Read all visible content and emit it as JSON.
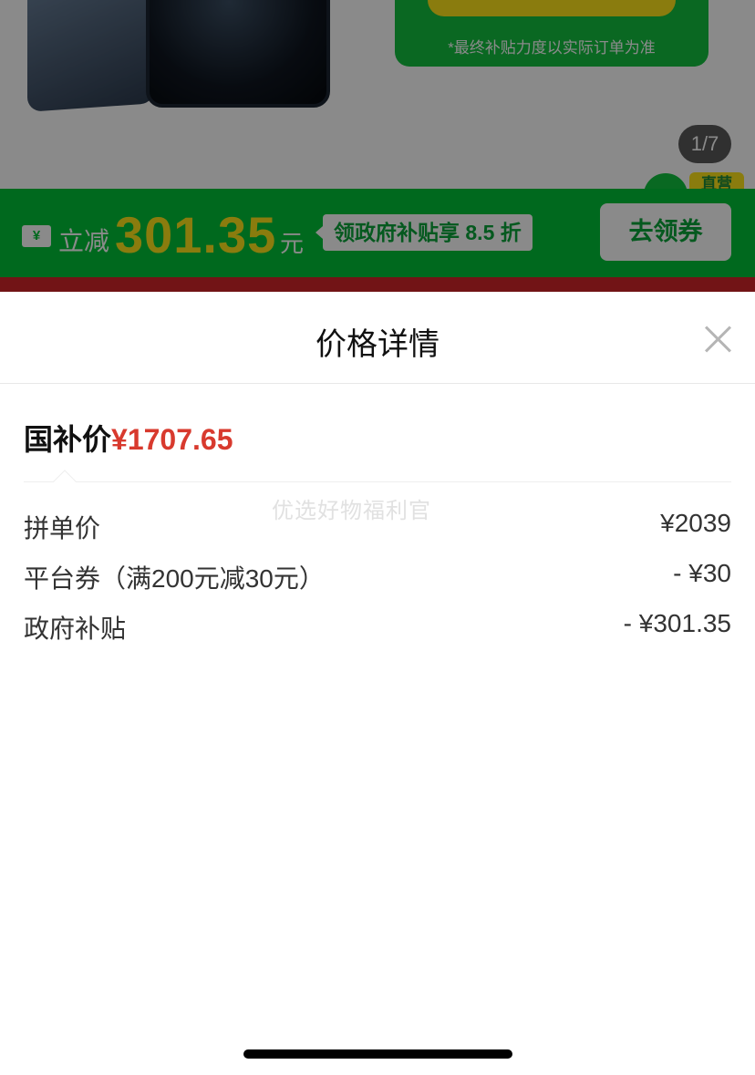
{
  "background": {
    "promo_note": "*最终补贴力度以实际订单为准",
    "page_counter": "1/7",
    "live_tag": "直营",
    "subsidy_bar": {
      "ticket_symbol": "¥",
      "label": "立减",
      "amount": "301.35",
      "unit": "元",
      "discount_tag": "领政府补贴享 8.5 折",
      "cta": "去领券"
    }
  },
  "sheet": {
    "title": "价格详情",
    "final": {
      "label": "国补价",
      "price": "¥1707.65"
    },
    "watermark": "优选好物福利官",
    "rows": [
      {
        "label": "拼单价",
        "value": "¥2039"
      },
      {
        "label": "平台券（满200元减30元）",
        "value": "- ¥30"
      },
      {
        "label": "政府补贴",
        "value": "- ¥301.35"
      }
    ]
  },
  "colors": {
    "accent_green": "#00c238",
    "price_red": "#d83a2e",
    "promo_yellow": "#ffe51a"
  }
}
